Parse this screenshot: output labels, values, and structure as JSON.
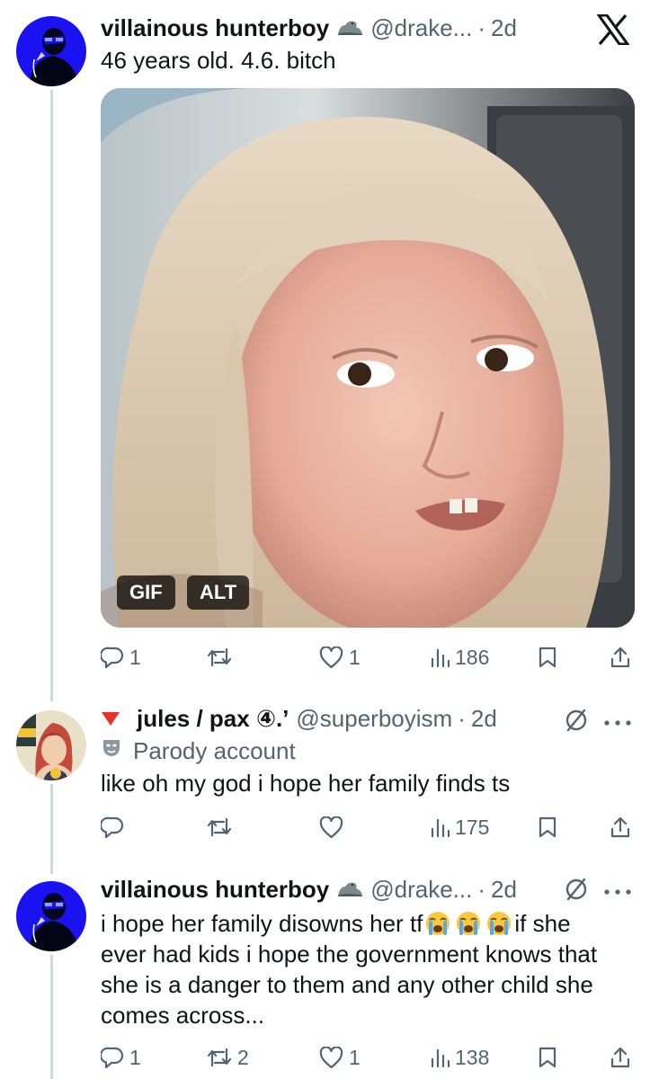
{
  "app": {
    "logo": "x-logo-icon"
  },
  "tweets": [
    {
      "display_name": "villainous hunterboy",
      "handle": "@drake...",
      "separator": "·",
      "time": "2d",
      "text": "46 years old. 4.6. bitch",
      "media": {
        "badge_gif": "GIF",
        "badge_alt": "ALT"
      },
      "actions": {
        "replies": "1",
        "reposts": "",
        "likes": "1",
        "views": "186"
      }
    },
    {
      "display_name": "jules / pax ④.’",
      "handle": "@superboyism",
      "separator": "·",
      "time": "2d",
      "label": "Parody account",
      "text": "like oh my god i hope her family finds ts",
      "actions": {
        "replies": "",
        "reposts": "",
        "likes": "",
        "views": "175"
      }
    },
    {
      "display_name": "villainous hunterboy",
      "handle": "@drake...",
      "separator": "·",
      "time": "2d",
      "text_before": "i hope her family disowns her tf",
      "text_after": "if she ever had kids i hope the government knows that she is a danger to them and any other child she comes across...",
      "actions": {
        "replies": "1",
        "reposts": "2",
        "likes": "1",
        "views": "138"
      }
    }
  ]
}
